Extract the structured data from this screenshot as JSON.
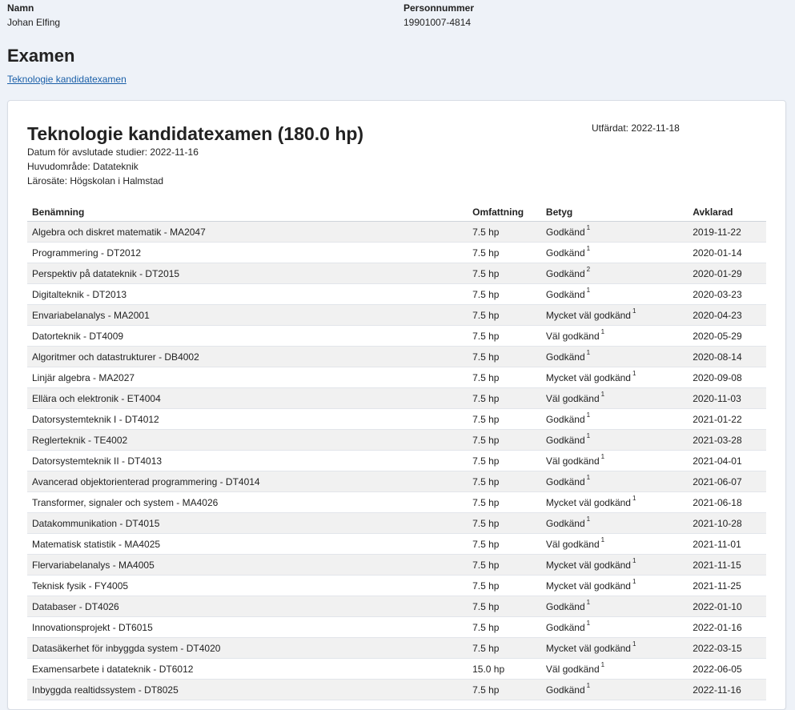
{
  "student": {
    "name_label": "Namn",
    "name_value": "Johan Elfing",
    "pnr_label": "Personnummer",
    "pnr_value": "19901007-4814"
  },
  "page_title": "Examen",
  "exam_link": "Teknologie kandidatexamen",
  "card": {
    "title": "Teknologie kandidatexamen (180.0 hp)",
    "issued": "Utfärdat: 2022-11-18",
    "meta": [
      "Datum för avslutade studier: 2022-11-16",
      "Huvudområde: Datateknik",
      "Lärosäte: Högskolan i Halmstad"
    ]
  },
  "table": {
    "headers": [
      "Benämning",
      "Omfattning",
      "Betyg",
      "Avklarad"
    ],
    "rows": [
      {
        "name": "Algebra och diskret matematik - MA2047",
        "scope": "7.5 hp",
        "grade": "Godkänd",
        "note": "1",
        "date": "2019-11-22"
      },
      {
        "name": "Programmering - DT2012",
        "scope": "7.5 hp",
        "grade": "Godkänd",
        "note": "1",
        "date": "2020-01-14"
      },
      {
        "name": "Perspektiv på datateknik - DT2015",
        "scope": "7.5 hp",
        "grade": "Godkänd",
        "note": "2",
        "date": "2020-01-29"
      },
      {
        "name": "Digitalteknik - DT2013",
        "scope": "7.5 hp",
        "grade": "Godkänd",
        "note": "1",
        "date": "2020-03-23"
      },
      {
        "name": "Envariabelanalys - MA2001",
        "scope": "7.5 hp",
        "grade": "Mycket väl godkänd",
        "note": "1",
        "date": "2020-04-23"
      },
      {
        "name": "Datorteknik - DT4009",
        "scope": "7.5 hp",
        "grade": "Väl godkänd",
        "note": "1",
        "date": "2020-05-29"
      },
      {
        "name": "Algoritmer och datastrukturer - DB4002",
        "scope": "7.5 hp",
        "grade": "Godkänd",
        "note": "1",
        "date": "2020-08-14"
      },
      {
        "name": "Linjär algebra - MA2027",
        "scope": "7.5 hp",
        "grade": "Mycket väl godkänd",
        "note": "1",
        "date": "2020-09-08"
      },
      {
        "name": "Ellära och elektronik - ET4004",
        "scope": "7.5 hp",
        "grade": "Väl godkänd",
        "note": "1",
        "date": "2020-11-03"
      },
      {
        "name": "Datorsystemteknik I - DT4012",
        "scope": "7.5 hp",
        "grade": "Godkänd",
        "note": "1",
        "date": "2021-01-22"
      },
      {
        "name": "Reglerteknik - TE4002",
        "scope": "7.5 hp",
        "grade": "Godkänd",
        "note": "1",
        "date": "2021-03-28"
      },
      {
        "name": "Datorsystemteknik II - DT4013",
        "scope": "7.5 hp",
        "grade": "Väl godkänd",
        "note": "1",
        "date": "2021-04-01"
      },
      {
        "name": "Avancerad objektorienterad programmering - DT4014",
        "scope": "7.5 hp",
        "grade": "Godkänd",
        "note": "1",
        "date": "2021-06-07"
      },
      {
        "name": "Transformer, signaler och system - MA4026",
        "scope": "7.5 hp",
        "grade": "Mycket väl godkänd",
        "note": "1",
        "date": "2021-06-18"
      },
      {
        "name": "Datakommunikation - DT4015",
        "scope": "7.5 hp",
        "grade": "Godkänd",
        "note": "1",
        "date": "2021-10-28"
      },
      {
        "name": "Matematisk statistik - MA4025",
        "scope": "7.5 hp",
        "grade": "Väl godkänd",
        "note": "1",
        "date": "2021-11-01"
      },
      {
        "name": "Flervariabelanalys - MA4005",
        "scope": "7.5 hp",
        "grade": "Mycket väl godkänd",
        "note": "1",
        "date": "2021-11-15"
      },
      {
        "name": "Teknisk fysik - FY4005",
        "scope": "7.5 hp",
        "grade": "Mycket väl godkänd",
        "note": "1",
        "date": "2021-11-25"
      },
      {
        "name": "Databaser - DT4026",
        "scope": "7.5 hp",
        "grade": "Godkänd",
        "note": "1",
        "date": "2022-01-10"
      },
      {
        "name": "Innovationsprojekt - DT6015",
        "scope": "7.5 hp",
        "grade": "Godkänd",
        "note": "1",
        "date": "2022-01-16"
      },
      {
        "name": "Datasäkerhet för inbyggda system - DT4020",
        "scope": "7.5 hp",
        "grade": "Mycket väl godkänd",
        "note": "1",
        "date": "2022-03-15"
      },
      {
        "name": "Examensarbete i datateknik - DT6012",
        "scope": "15.0 hp",
        "grade": "Väl godkänd",
        "note": "1",
        "date": "2022-06-05"
      },
      {
        "name": "Inbyggda realtidssystem - DT8025",
        "scope": "7.5 hp",
        "grade": "Godkänd",
        "note": "1",
        "date": "2022-11-16"
      }
    ]
  }
}
